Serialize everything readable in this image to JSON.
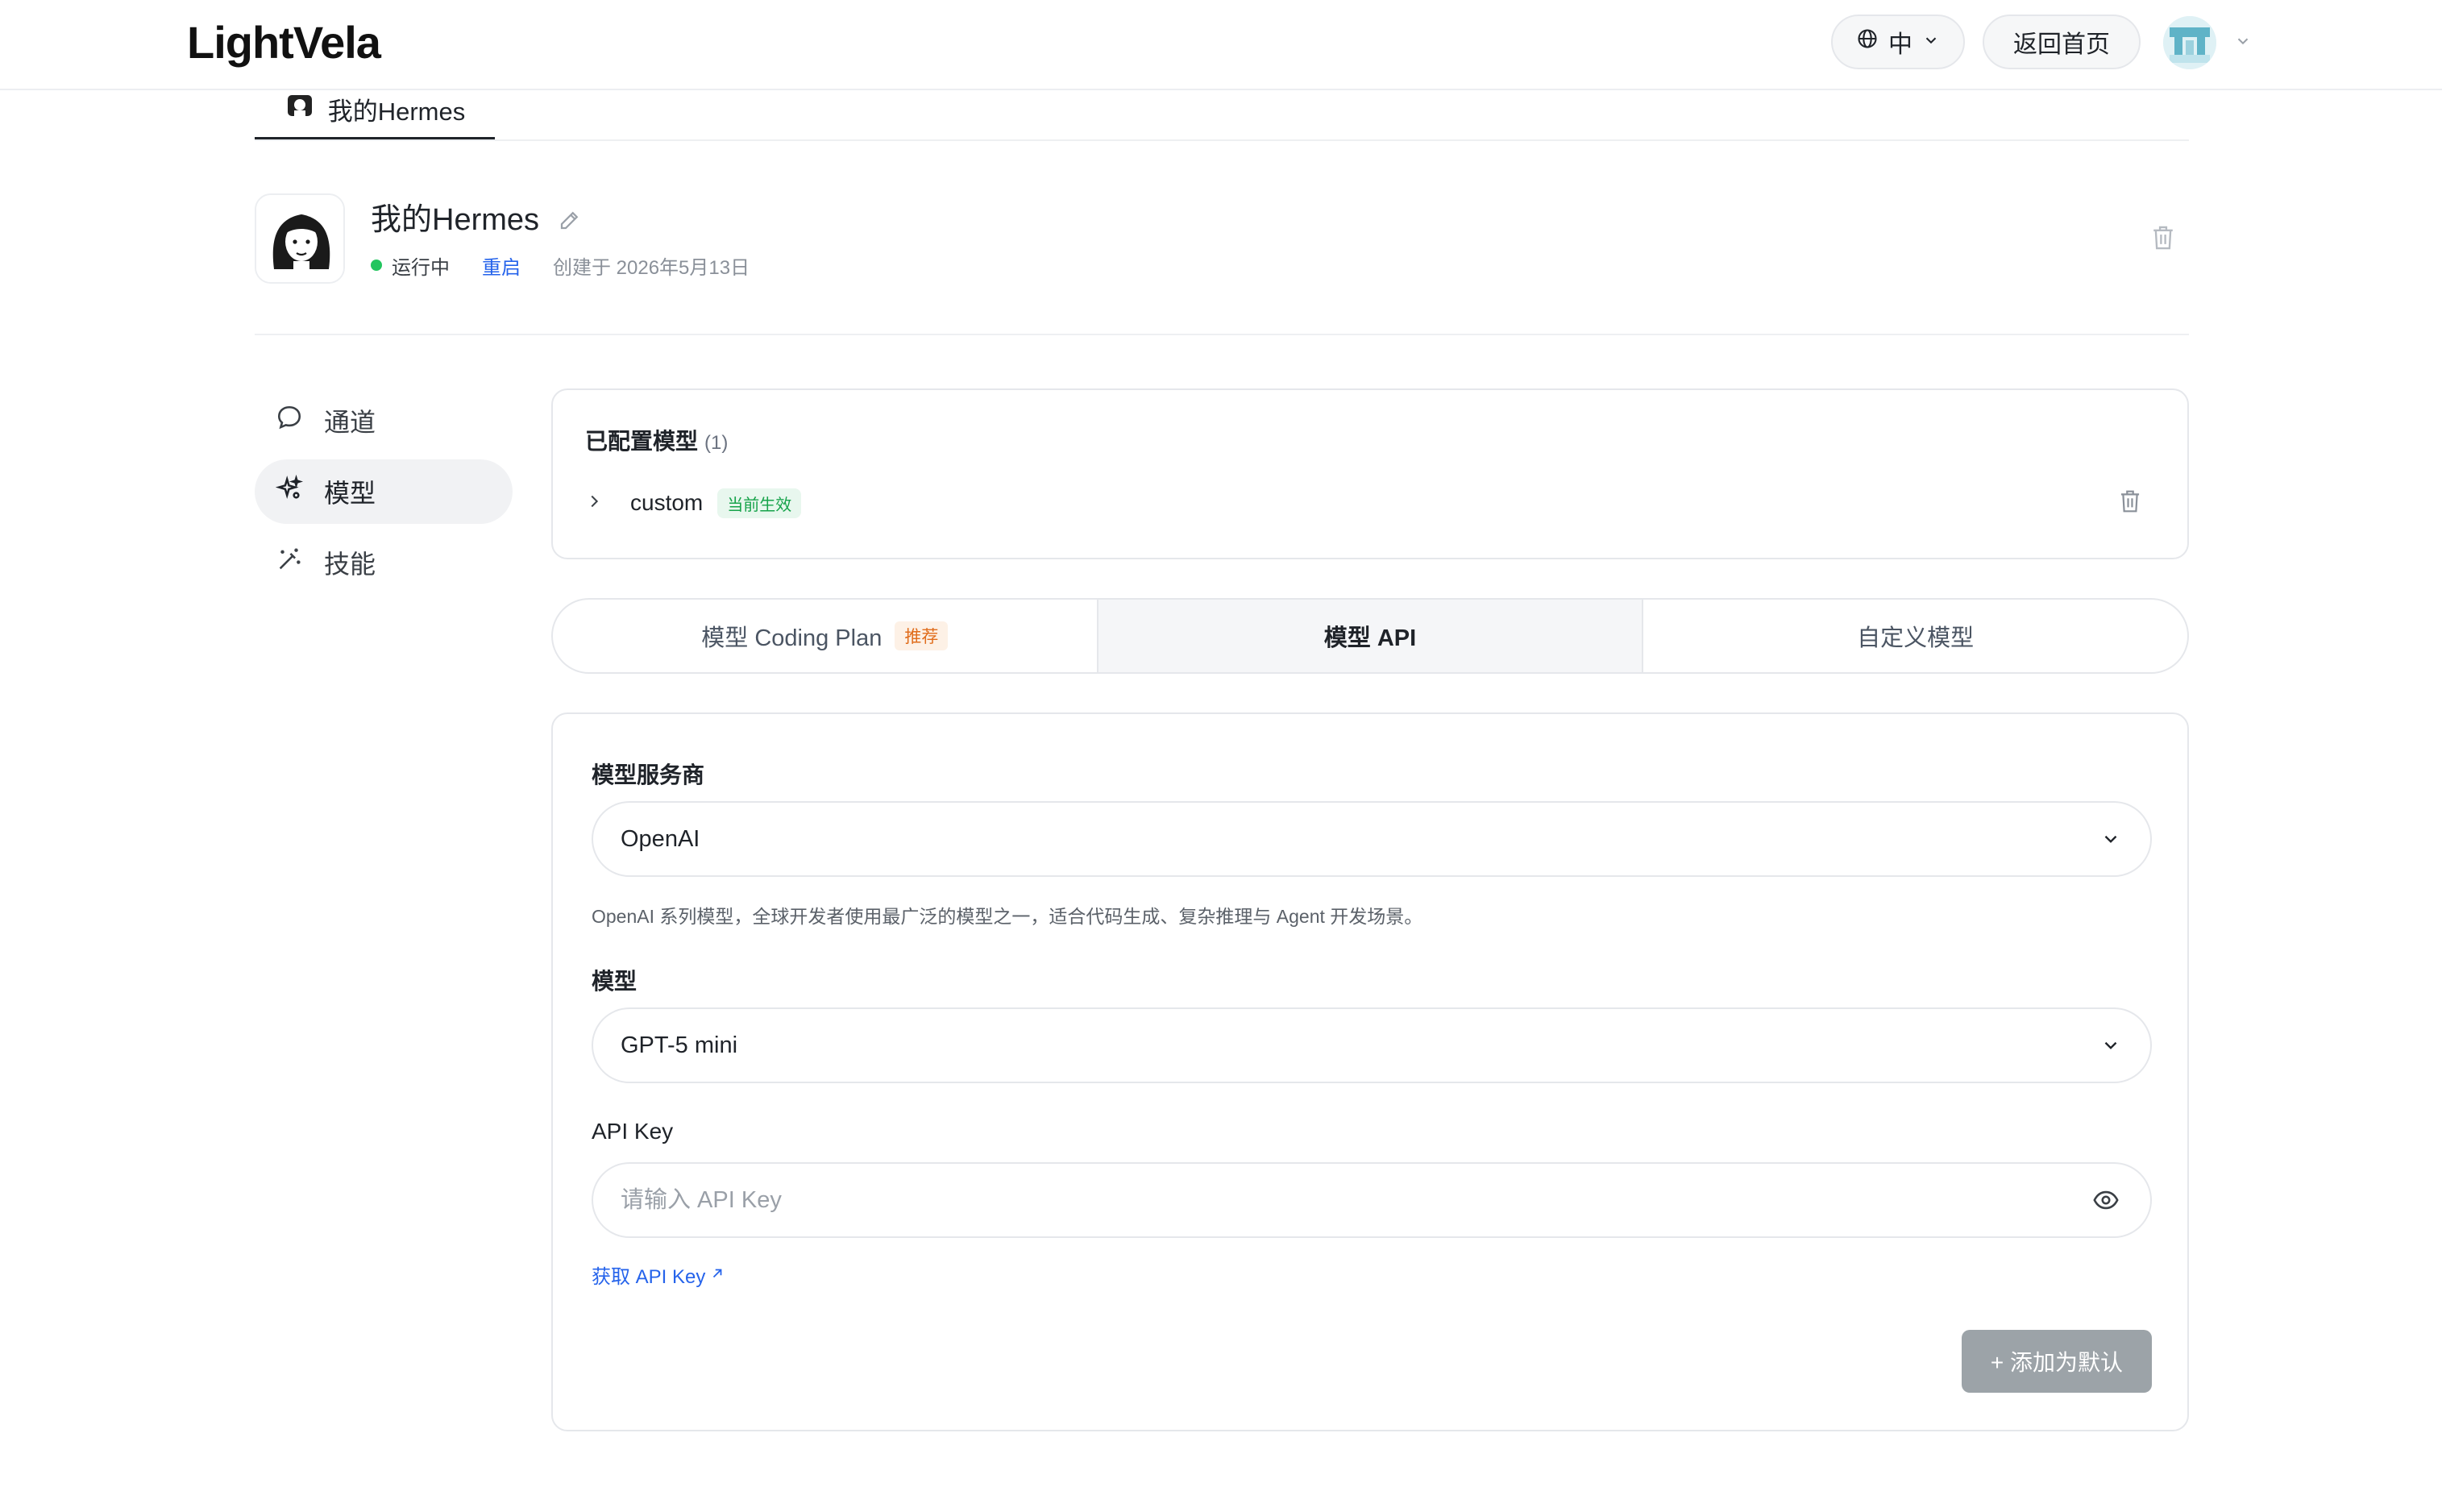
{
  "header": {
    "logo": "LightVela",
    "language_label": "中",
    "home_button": "返回首页",
    "icons": [
      "globe-icon",
      "chevron-down-icon",
      "avatar",
      "chevron-down-icon"
    ]
  },
  "tabs": [
    {
      "label": "我的Hermes",
      "active": true
    }
  ],
  "agent": {
    "name": "我的Hermes",
    "status": "运行中",
    "status_color": "#22c55e",
    "restart_label": "重启",
    "created": "创建于 2026年5月13日"
  },
  "sidebar": {
    "items": [
      {
        "label": "通道",
        "icon": "chat-bubble-icon",
        "active": false
      },
      {
        "label": "模型",
        "icon": "sparkle-icon",
        "active": true
      },
      {
        "label": "技能",
        "icon": "magic-wand-icon",
        "active": false
      }
    ]
  },
  "configured": {
    "title": "已配置模型",
    "count": "(1)",
    "models": [
      {
        "name": "custom",
        "badge": "当前生效"
      }
    ]
  },
  "mode_tabs": [
    {
      "label": "模型 Coding Plan",
      "badge": "推荐",
      "active": false
    },
    {
      "label": "模型 API",
      "active": true
    },
    {
      "label": "自定义模型",
      "active": false
    }
  ],
  "form": {
    "provider_label": "模型服务商",
    "provider_value": "OpenAI",
    "provider_description": "OpenAI 系列模型，全球开发者使用最广泛的模型之一，适合代码生成、复杂推理与 Agent 开发场景。",
    "model_label": "模型",
    "model_value": "GPT-5 mini",
    "apikey_label": "API Key",
    "apikey_placeholder": "请输入 API Key",
    "get_key_link": "获取 API Key",
    "add_button": "+ 添加为默认"
  },
  "colors": {
    "accent_link": "#2563eb",
    "recommend_badge": "#e06c1b",
    "active_badge": "#16a34a",
    "disabled_button": "#9ca3a8"
  }
}
